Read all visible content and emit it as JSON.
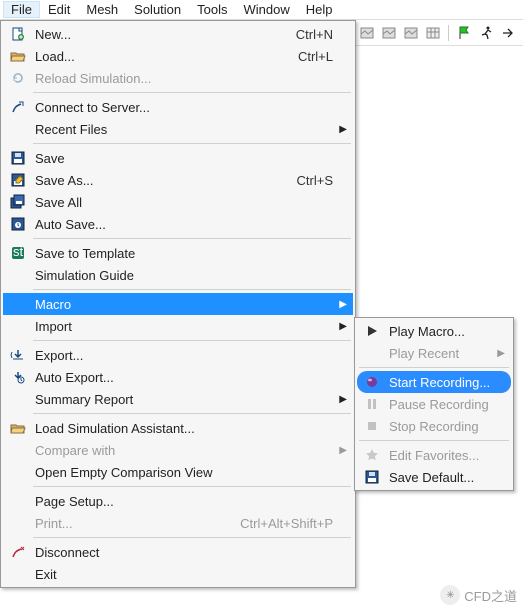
{
  "menubar": [
    "File",
    "Edit",
    "Mesh",
    "Solution",
    "Tools",
    "Window",
    "Help"
  ],
  "menubar_active": 0,
  "file_menu": {
    "groups": [
      [
        {
          "icon": "new",
          "label": "New...",
          "accel": "Ctrl+N",
          "en": true
        },
        {
          "icon": "open",
          "label": "Load...",
          "accel": "Ctrl+L",
          "en": true
        },
        {
          "icon": "reload",
          "label": "Reload Simulation...",
          "en": false
        }
      ],
      [
        {
          "icon": "connect",
          "label": "Connect to Server...",
          "en": true
        },
        {
          "icon": "",
          "label": "Recent Files",
          "en": true,
          "sub": true
        }
      ],
      [
        {
          "icon": "save",
          "label": "Save",
          "en": true
        },
        {
          "icon": "saveas",
          "label": "Save As...",
          "accel": "Ctrl+S",
          "en": true
        },
        {
          "icon": "saveall",
          "label": "Save All",
          "en": true
        },
        {
          "icon": "autosave",
          "label": "Auto Save...",
          "en": true
        }
      ],
      [
        {
          "icon": "template",
          "label": "Save to Template",
          "en": true
        },
        {
          "icon": "",
          "label": "Simulation Guide",
          "en": true
        }
      ],
      [
        {
          "icon": "",
          "label": "Macro",
          "en": true,
          "sub": true,
          "hl": true
        },
        {
          "icon": "",
          "label": "Import",
          "en": true,
          "sub": true
        }
      ],
      [
        {
          "icon": "export",
          "label": "Export...",
          "en": true
        },
        {
          "icon": "autoexport",
          "label": "Auto Export...",
          "en": true
        },
        {
          "icon": "",
          "label": "Summary Report",
          "en": true,
          "sub": true
        }
      ],
      [
        {
          "icon": "open",
          "label": "Load Simulation Assistant...",
          "en": true
        },
        {
          "icon": "",
          "label": "Compare with",
          "en": false,
          "sub": true
        },
        {
          "icon": "",
          "label": "Open Empty Comparison View",
          "en": true
        }
      ],
      [
        {
          "icon": "",
          "label": "Page Setup...",
          "en": true
        },
        {
          "icon": "",
          "label": "Print...",
          "accel": "Ctrl+Alt+Shift+P",
          "en": false
        }
      ],
      [
        {
          "icon": "disconnect",
          "label": "Disconnect",
          "en": true
        },
        {
          "icon": "",
          "label": "Exit",
          "en": true
        }
      ]
    ]
  },
  "macro_menu": {
    "groups": [
      [
        {
          "icon": "play",
          "label": "Play Macro...",
          "en": true
        },
        {
          "icon": "",
          "label": "Play Recent",
          "en": false,
          "sub": true
        }
      ],
      [
        {
          "icon": "record",
          "label": "Start Recording...",
          "en": true,
          "hl": true
        },
        {
          "icon": "pause",
          "label": "Pause Recording",
          "en": false
        },
        {
          "icon": "stop",
          "label": "Stop Recording",
          "en": false
        }
      ],
      [
        {
          "icon": "star",
          "label": "Edit Favorites...",
          "en": false
        },
        {
          "icon": "save",
          "label": "Save Default...",
          "en": true
        }
      ]
    ]
  },
  "toolbar_icons": [
    "scene1",
    "scene2",
    "scene3",
    "grid",
    "sep",
    "flag",
    "runner",
    "arrow"
  ],
  "watermark": "CFD之道"
}
